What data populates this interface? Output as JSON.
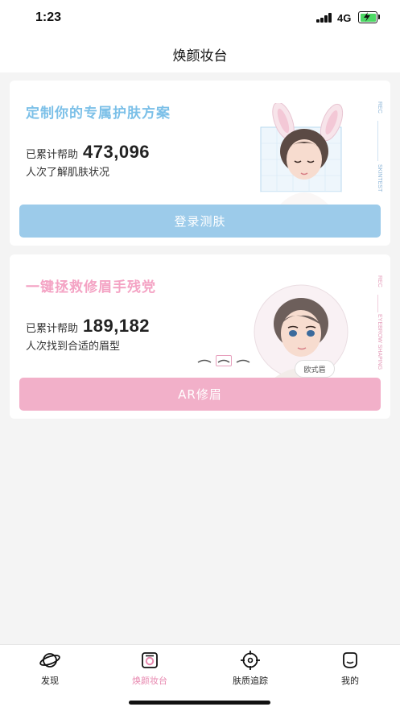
{
  "status_bar": {
    "time": "1:23",
    "network": "4G"
  },
  "nav": {
    "title": "焕颜妆台"
  },
  "skin_card": {
    "title": "定制你的专属护肤方案",
    "stat_prefix": "已累计帮助",
    "stat_number": "473,096",
    "stat_suffix": "人次了解肌肤状况",
    "button_label": "登录测肤",
    "side_rec": "REC",
    "side_tag": "SKINTEST"
  },
  "brow_card": {
    "title": "一键拯救修眉手残党",
    "stat_prefix": "已累计帮助",
    "stat_number": "189,182",
    "stat_suffix": "人次找到合适的眉型",
    "button_label": "AR修眉",
    "badge": "欧式眉",
    "side_rec": "REC",
    "side_tag": "EYEBROW SHAPING"
  },
  "tabs": [
    {
      "label": "发现",
      "icon": "planet-icon"
    },
    {
      "label": "焕颜妆台",
      "icon": "camera-icon"
    },
    {
      "label": "肤质追踪",
      "icon": "target-icon"
    },
    {
      "label": "我的",
      "icon": "face-icon"
    }
  ],
  "colors": {
    "skin_accent": "#7cc0e8",
    "brow_accent": "#f4a3c4",
    "active_tab": "#e889b0"
  }
}
